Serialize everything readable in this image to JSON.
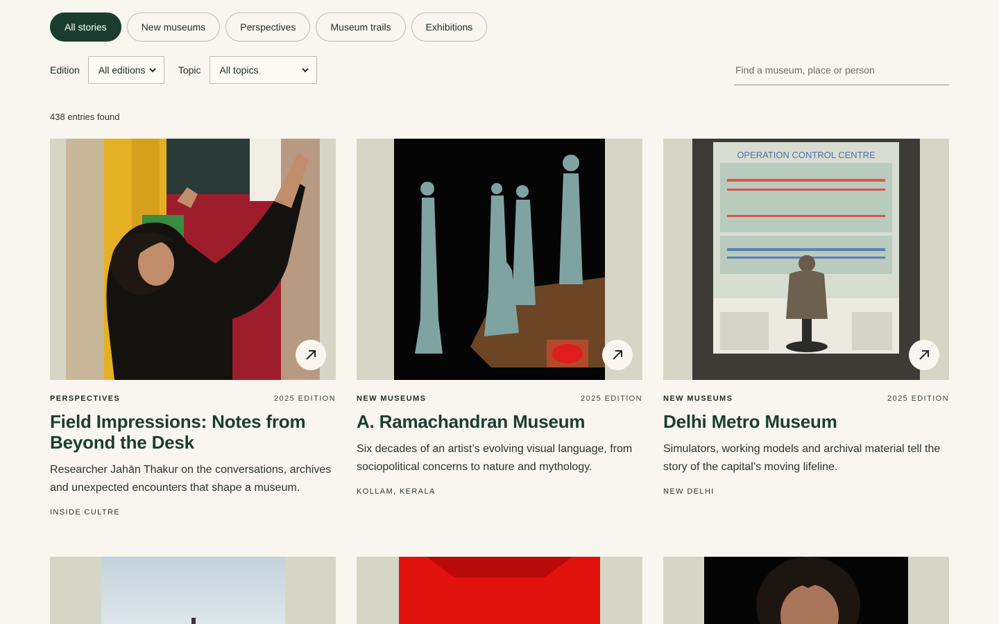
{
  "tabs": [
    {
      "label": "All stories",
      "active": true
    },
    {
      "label": "New museums",
      "active": false
    },
    {
      "label": "Perspectives",
      "active": false
    },
    {
      "label": "Museum trails",
      "active": false
    },
    {
      "label": "Exhibitions",
      "active": false
    }
  ],
  "filters": {
    "edition_label": "Edition",
    "edition_value": "All editions",
    "topic_label": "Topic",
    "topic_value": "All topics"
  },
  "search": {
    "placeholder": "Find a museum, place or person"
  },
  "results": {
    "count_text": "438 entries found"
  },
  "cards": [
    {
      "category": "Perspectives",
      "edition": "2025 Edition",
      "title": "Field Impressions: Notes from Beyond the Desk",
      "description": "Researcher Jahān Thakur on the conversations, archives and unexpected encounters that shape a museum.",
      "location": "Inside Cultre"
    },
    {
      "category": "New museums",
      "edition": "2025 Edition",
      "title": "A. Ramachandran Museum",
      "description": "Six decades of an artist’s evolving visual language, from sociopolitical concerns to nature and mythology.",
      "location": "Kollam, Kerala"
    },
    {
      "category": "New museums",
      "edition": "2025 Edition",
      "title": "Delhi Metro Museum",
      "description": "Simulators, working models and archival material tell the story of the capital’s moving lifeline.",
      "location": "New Delhi"
    }
  ],
  "image_text": {
    "control_centre_sign": "OPERATION CONTROL CENTRE"
  },
  "colors": {
    "accent": "#1b3d2f",
    "background": "#f8f6ee",
    "thumb_bg": "#d5d6c6"
  }
}
